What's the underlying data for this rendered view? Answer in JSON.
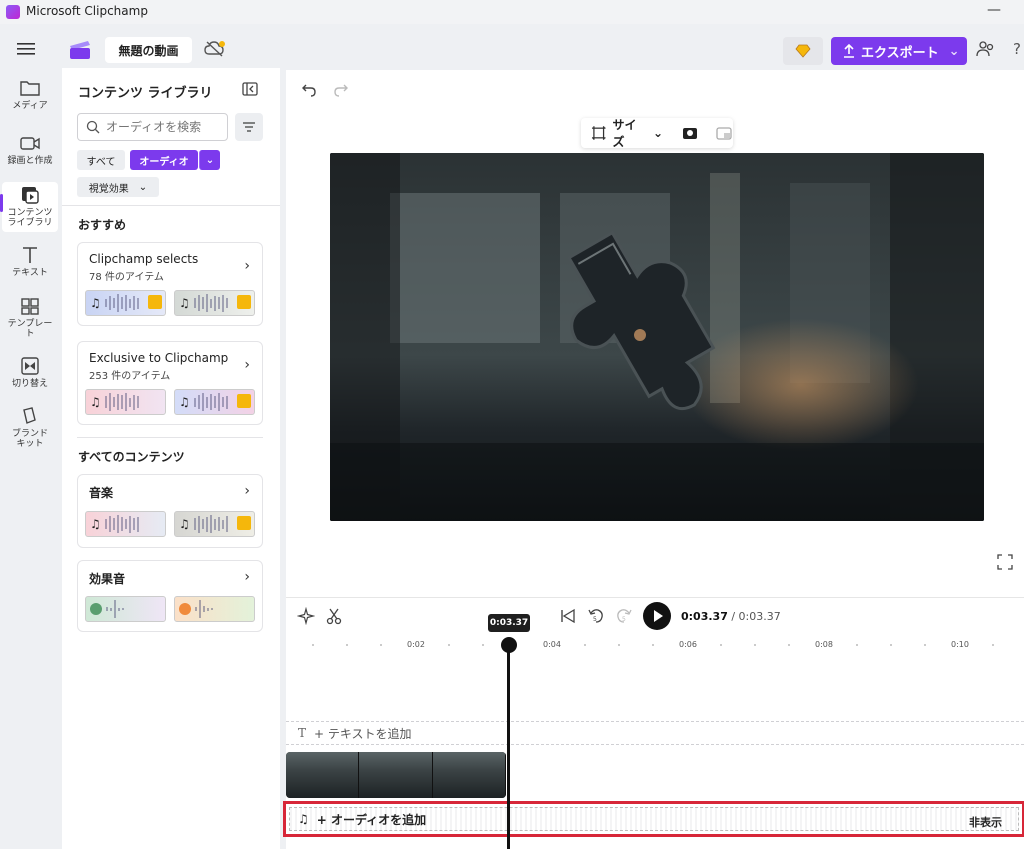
{
  "window": {
    "title": "Microsoft Clipchamp"
  },
  "header": {
    "project_title": "無題の動画",
    "export_label": "エクスポート",
    "help_label": "?"
  },
  "rail": [
    {
      "label": "メディア"
    },
    {
      "label": "録画と作成"
    },
    {
      "label": "コンテンツ\nライブラリ"
    },
    {
      "label": "テキスト"
    },
    {
      "label": "テンプレー\nト"
    },
    {
      "label": "切り替え"
    },
    {
      "label": "ブランド\nキット"
    }
  ],
  "library": {
    "title": "コンテンツ ライブラリ",
    "search_placeholder": "オーディオを検索",
    "chips": [
      "すべて",
      "オーディオ",
      "視覚効果"
    ],
    "recommended_heading": "おすすめ",
    "cards_recommended": [
      {
        "title": "Clipchamp selects",
        "count": "78 件のアイテム"
      },
      {
        "title": "Exclusive to Clipchamp",
        "count": "253 件のアイテム"
      }
    ],
    "all_heading": "すべてのコンテンツ",
    "cards_all": [
      {
        "title": "音楽"
      },
      {
        "title": "効果音"
      }
    ]
  },
  "preview": {
    "size_label": "サイズ"
  },
  "timeline": {
    "current_time": "0:03.37",
    "total_time": "/ 0:03.37",
    "playhead_label": "0:03.37",
    "ruler_labels": [
      "0:02",
      "0:04",
      "0:06",
      "0:08",
      "0:10"
    ],
    "add_text": "+ テキストを追加",
    "add_audio": "+ オーディオを追加",
    "hide_label": "非表示"
  },
  "colors": {
    "accent": "#7c3aed",
    "highlight": "#d72638"
  }
}
